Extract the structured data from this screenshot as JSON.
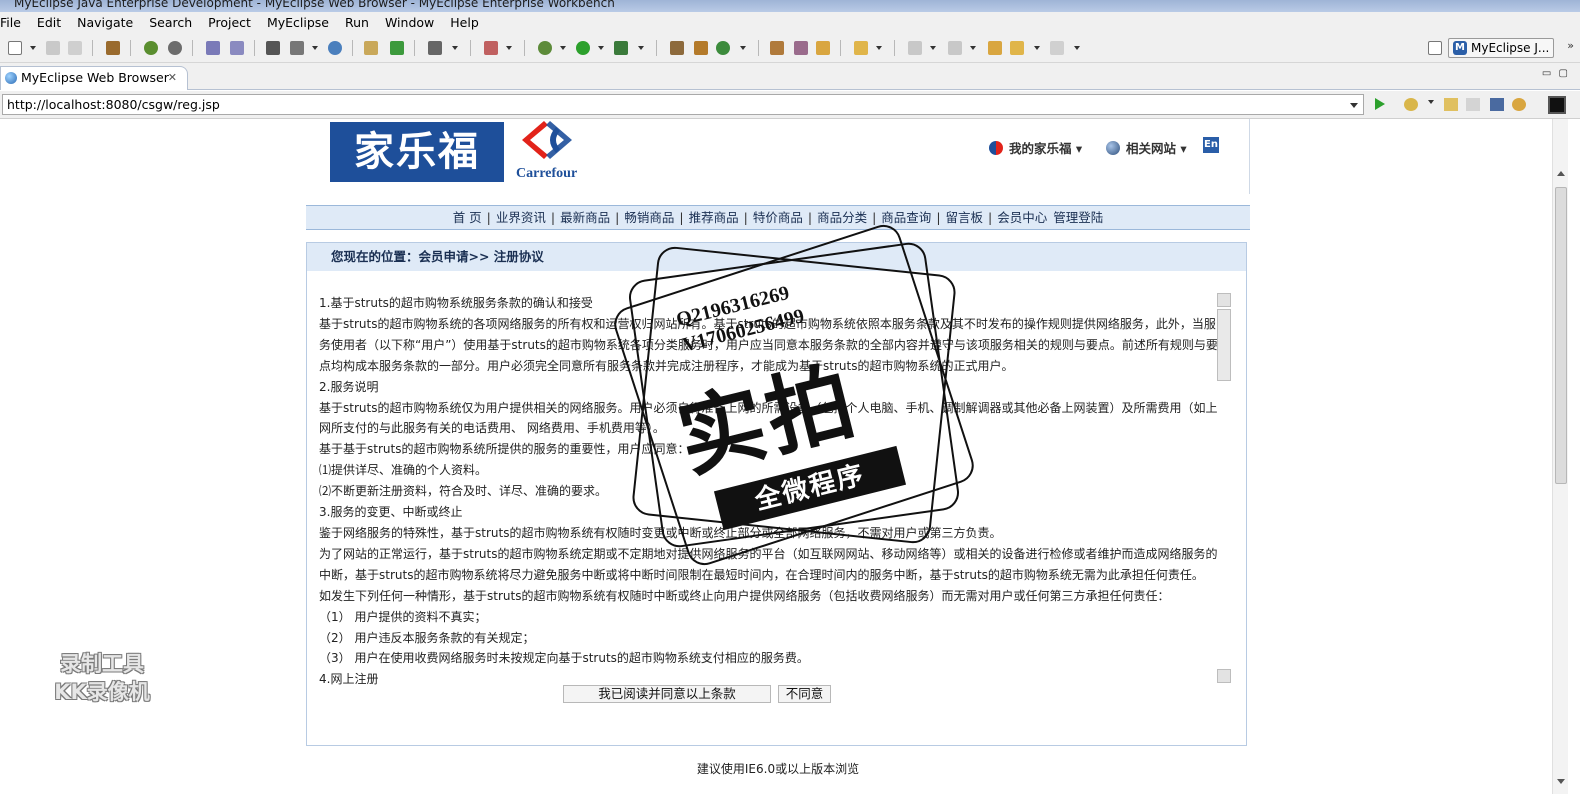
{
  "window": {
    "title": "MyEclipse Java Enterprise Development - MyEclipse Web Browser - MyEclipse Enterprise Workbench"
  },
  "menubar": {
    "items": [
      "File",
      "Edit",
      "Navigate",
      "Search",
      "Project",
      "MyEclipse",
      "Run",
      "Window",
      "Help"
    ]
  },
  "toolbar": {
    "perspective_label": "MyEclipse J...",
    "perspective_badge": "M"
  },
  "editor_tab": {
    "label": "MyEclipse Web Browser",
    "close": "✕"
  },
  "browser": {
    "url": "http://localhost:8080/csgw/reg.jsp"
  },
  "site": {
    "logo_cn": "家乐福",
    "logo_en": "Carrefour",
    "header_links": [
      "我的家乐福",
      "相关网站"
    ],
    "lang_badge": "En",
    "nav": [
      "首 页",
      "业界资讯",
      "最新商品",
      "畅销商品",
      "推荐商品",
      "特价商品",
      "商品分类",
      "商品查询",
      "留言板",
      "会员中心",
      "管理登陆"
    ],
    "breadcrumb": "您现在的位置：会员申请>> 注册协议",
    "agreement": [
      "1.基于struts的超市购物系统服务条款的确认和接受",
      "基于struts的超市购物系统的各项网络服务的所有权和运营权归网站所有。基于struts的超市购物系统依照本服务条款及其不时发布的操作规则提供网络服务，此外，当服务使用者（以下称“用户”）使用基于struts的超市购物系统各项分类服务时，用户应当同意本服务条款的全部内容并遵守与该项服务相关的规则与要点。前述所有规则与要点均构成本服务条款的一部分。用户必须完全同意所有服务条款并完成注册程序，才能成为基于struts的超市购物系统的正式用户。",
      "2.服务说明",
      "基于struts的超市购物系统仅为用户提供相关的网络服务。用户必须自行准备上网的所需设备（包括个人电脑、手机、调制解调器或其他必备上网装置）及所需费用（如上网所支付的与此服务有关的电话费用、 网络费用、手机费用等）。",
      "基于基于struts的超市购物系统所提供的服务的重要性，用户应同意：",
      "⑴提供详尽、准确的个人资料。",
      "⑵不断更新注册资料，符合及时、详尽、准确的要求。",
      "3.服务的变更、中断或终止",
      "鉴于网络服务的特殊性，基于struts的超市购物系统有权随时变更或中断或终止部分或全部网络服务，不需对用户或第三方负责。",
      "为了网站的正常运行，基于struts的超市购物系统定期或不定期地对提供网络服务的平台（如互联网网站、移动网络等）或相关的设备进行检修或者维护而造成网络服务的中断，基于struts的超市购物系统将尽力避免服务中断或将中断时间限制在最短时间内，在合理时间内的服务中断，基于struts的超市购物系统无需为此承担任何责任。",
      "如发生下列任何一种情形，基于struts的超市购物系统有权随时中断或终止向用户提供网络服务（包括收费网络服务）而无需对用户或任何第三方承担任何责任：",
      "（1） 用户提供的资料不真实；",
      "（2） 用户违反本服务条款的有关规定；",
      "（3） 用户在使用收费网络服务时未按规定向基于struts的超市购物系统支付相应的服务费。",
      "4.网上注册"
    ],
    "agree_button": "我已阅读并同意以上条款",
    "disagree_button": "不同意",
    "footer": "建议使用IE6.0或以上版本浏览"
  },
  "overlays": {
    "stamp_numbers": [
      "Q2196316269",
      "V17060256499"
    ],
    "stamp_big": "实拍",
    "stamp_ribbon": "全微程序",
    "watermark": [
      "录制工具",
      "KK录像机"
    ]
  },
  "colors": {
    "brand_blue": "#1e4f9a",
    "carrefour_red": "#e2231a",
    "nav_bg": "#dfeaf7"
  }
}
